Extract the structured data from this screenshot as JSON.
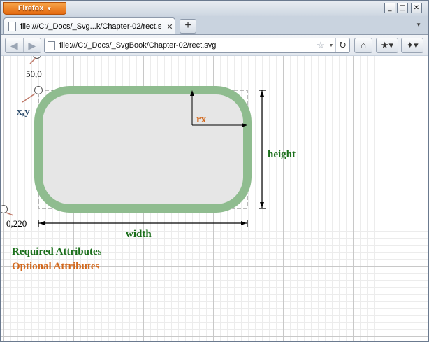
{
  "browser": {
    "app_button": "Firefox",
    "window_controls": {
      "minimize": "_",
      "maximize": "□",
      "close": "✕"
    },
    "tab": {
      "title": "file:///C:/_Docs/_Svg...k/Chapter-02/rect.svg",
      "close": "✕"
    },
    "new_tab": "+",
    "url": "file:///C:/_Docs/_SvgBook/Chapter-02/rect.svg",
    "icons": [
      "back-icon",
      "forward-icon",
      "page-icon",
      "bookmark-star-icon",
      "reload-icon",
      "home-icon",
      "bookmarks-icon",
      "addon-icon"
    ]
  },
  "diagram": {
    "origin_label": "50,0",
    "xy_label": "x,y",
    "left_label": "0,220",
    "rx_label": "rx",
    "height_label": "height",
    "width_label": "width",
    "legend": {
      "required": "Required Attributes",
      "optional": "Optional Attributes"
    },
    "colors": {
      "required": "#1a6e1a",
      "optional": "#d2691e",
      "rect_stroke": "#8fbc8f",
      "rect_fill": "#e6e6e6"
    }
  }
}
